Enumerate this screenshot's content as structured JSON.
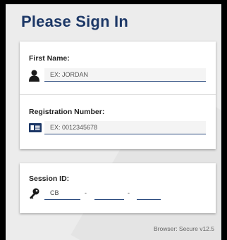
{
  "page": {
    "title": "Please Sign In"
  },
  "first_name": {
    "label": "First Name:",
    "placeholder": "EX: JORDAN",
    "value": ""
  },
  "registration": {
    "label": "Registration Number:",
    "placeholder": "EX: 0012345678",
    "value": ""
  },
  "session": {
    "label": "Session ID:",
    "part1": "CB",
    "part2": "",
    "part3": "",
    "separator": "-"
  },
  "footer": {
    "text": "Browser: Secure v12.5"
  },
  "colors": {
    "title": "#1c3766",
    "underline": "#2b4a7e",
    "background": "#ececec"
  },
  "icons": {
    "first_name": "person-icon",
    "registration": "id-card-icon",
    "session": "key-icon"
  }
}
